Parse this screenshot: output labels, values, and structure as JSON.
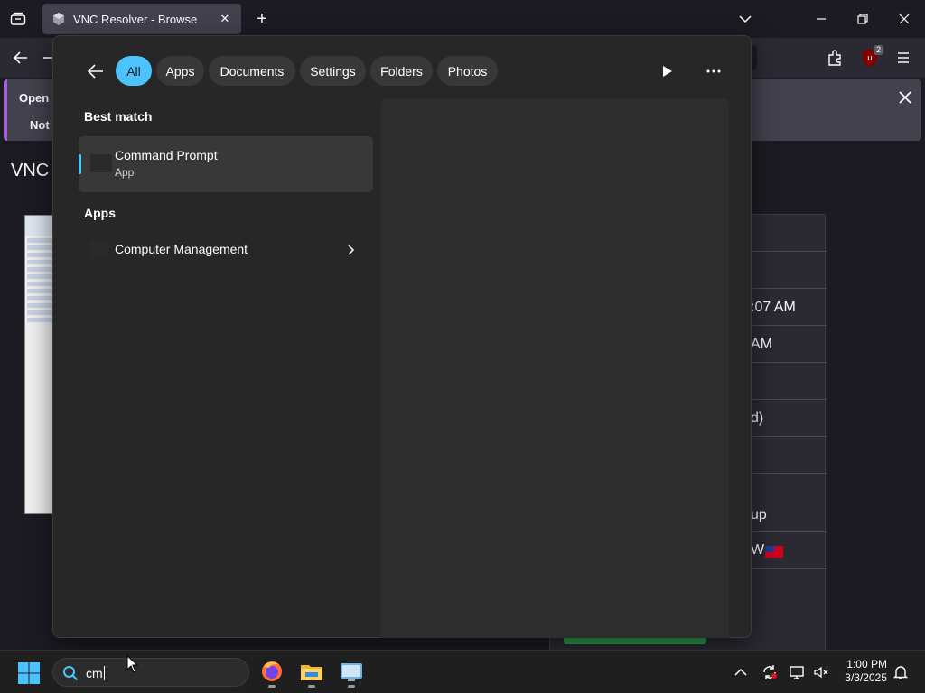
{
  "browser": {
    "tab_title": "VNC Resolver - Browse",
    "tab_close": "✕",
    "new_tab": "+",
    "extension_badge": "2"
  },
  "notification": {
    "line1": "Open F",
    "line2": "Not r"
  },
  "page": {
    "title": "VNC",
    "cells": [
      ":07 AM",
      "AM",
      "d)",
      "up",
      "W"
    ]
  },
  "search_flyout": {
    "filters": [
      "All",
      "Apps",
      "Documents",
      "Settings",
      "Folders",
      "Photos"
    ],
    "active_filter": "All",
    "best_match_heading": "Best match",
    "best_match": {
      "name": "Command Prompt",
      "type": "App"
    },
    "apps_heading": "Apps",
    "apps": [
      {
        "name": "Computer Management"
      }
    ]
  },
  "taskbar": {
    "search_text": "cm",
    "time": "1:00 PM",
    "date": "3/3/2025"
  },
  "colors": {
    "accent": "#4cc2ff",
    "flyout_bg": "#272727",
    "taskbar_bg": "#1f1f1f"
  }
}
